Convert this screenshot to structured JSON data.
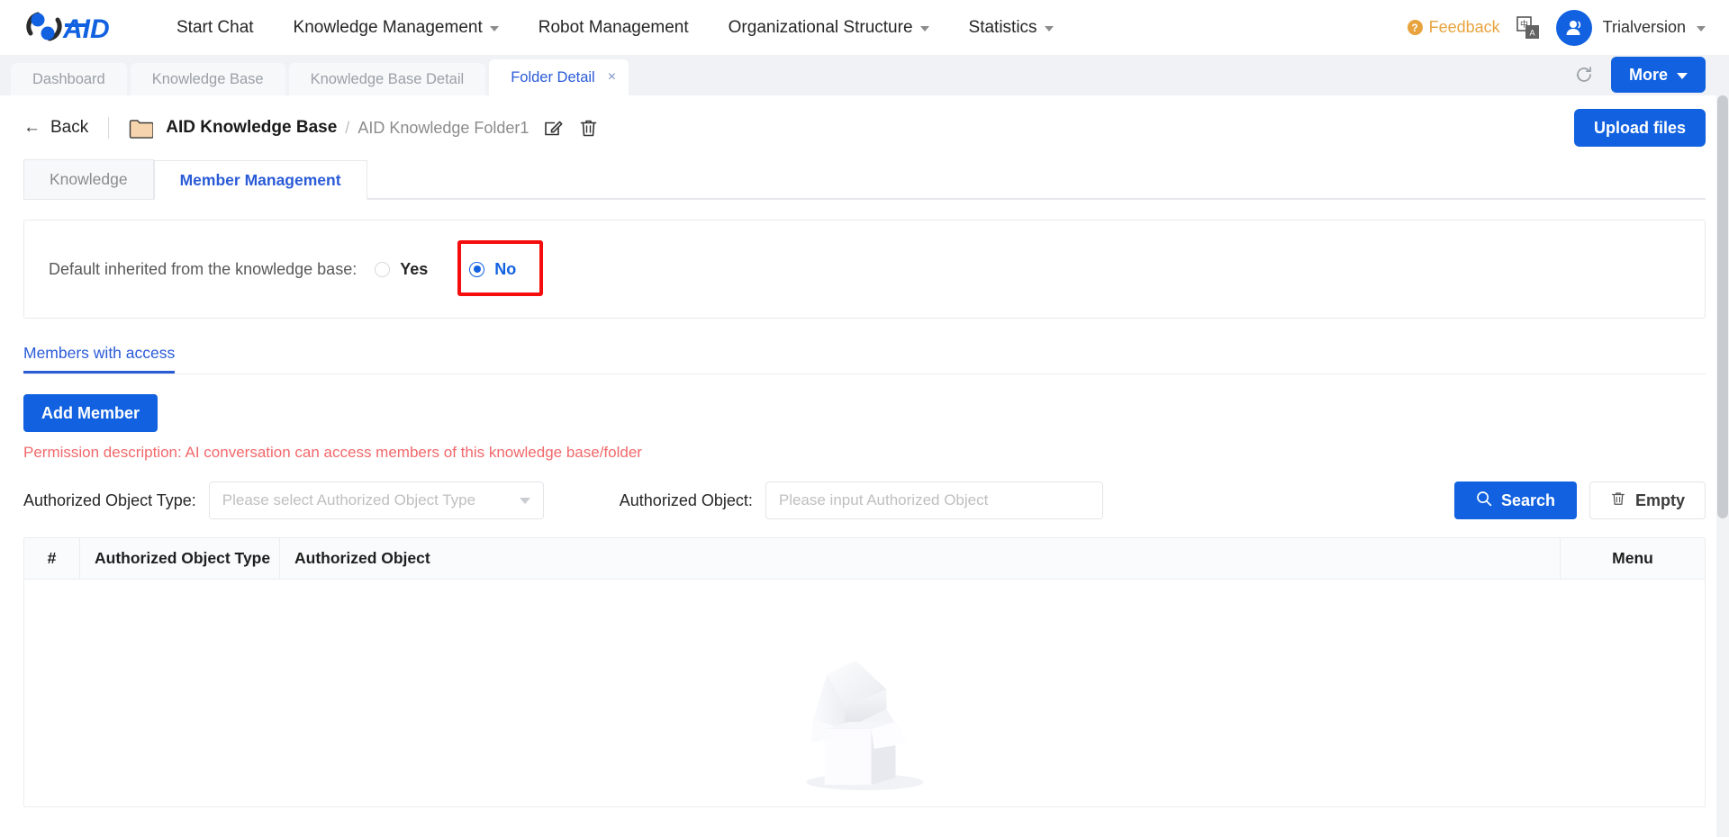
{
  "header": {
    "logo_text": "AID",
    "nav": [
      {
        "label": "Start Chat",
        "has_caret": false
      },
      {
        "label": "Knowledge Management",
        "has_caret": true
      },
      {
        "label": "Robot Management",
        "has_caret": false
      },
      {
        "label": "Organizational Structure",
        "has_caret": true
      },
      {
        "label": "Statistics",
        "has_caret": true
      }
    ],
    "feedback_label": "Feedback",
    "feedback_color": "#e8a33d",
    "language_icon": "translate-icon",
    "user_name": "Trialversion"
  },
  "tabstrip": {
    "tabs": [
      {
        "label": "Dashboard",
        "active": false,
        "closable": false
      },
      {
        "label": "Knowledge Base",
        "active": false,
        "closable": false
      },
      {
        "label": "Knowledge Base Detail",
        "active": false,
        "closable": false
      },
      {
        "label": "Folder Detail",
        "active": true,
        "closable": true
      }
    ],
    "close_glyph": "×",
    "refresh_icon": "refresh-icon",
    "more_label": "More"
  },
  "breadcrumb": {
    "back_label": "Back",
    "back_arrow": "←",
    "folder_icon": "folder-icon",
    "root": "AID Knowledge Base",
    "separator": "/",
    "current": "AID Knowledge Folder1",
    "edit_icon": "edit-icon",
    "delete_icon": "trash-icon",
    "upload_label": "Upload files"
  },
  "section_tabs": [
    {
      "label": "Knowledge",
      "active": false
    },
    {
      "label": "Member Management",
      "active": true
    }
  ],
  "inherit": {
    "label": "Default inherited from the knowledge base:",
    "options": [
      {
        "label": "Yes",
        "selected": false
      },
      {
        "label": "No",
        "selected": true
      }
    ],
    "highlight_color": "#f50c0c",
    "highlighted_option": "No"
  },
  "members": {
    "section_title": "Members with access",
    "add_member_label": "Add Member",
    "permission_description": "Permission description: AI conversation can access members of this knowledge base/folder",
    "permission_color": "#f2686b"
  },
  "filters": {
    "type_label": "Authorized Object Type:",
    "type_placeholder": "Please select Authorized Object Type",
    "type_value": "",
    "object_label": "Authorized Object:",
    "object_placeholder": "Please input Authorized Object",
    "object_value": "",
    "search_label": "Search",
    "search_icon": "search-icon",
    "empty_label": "Empty",
    "empty_icon": "trash-icon"
  },
  "table": {
    "columns": [
      "#",
      "Authorized Object Type",
      "Authorized Object",
      "Menu"
    ],
    "rows": [],
    "empty_illustration": "empty-box-illustration"
  },
  "theme": {
    "primary": "#1161e0",
    "link": "#2a5bd7",
    "muted": "#8c8c8c",
    "panel_border": "#e8eaed"
  }
}
